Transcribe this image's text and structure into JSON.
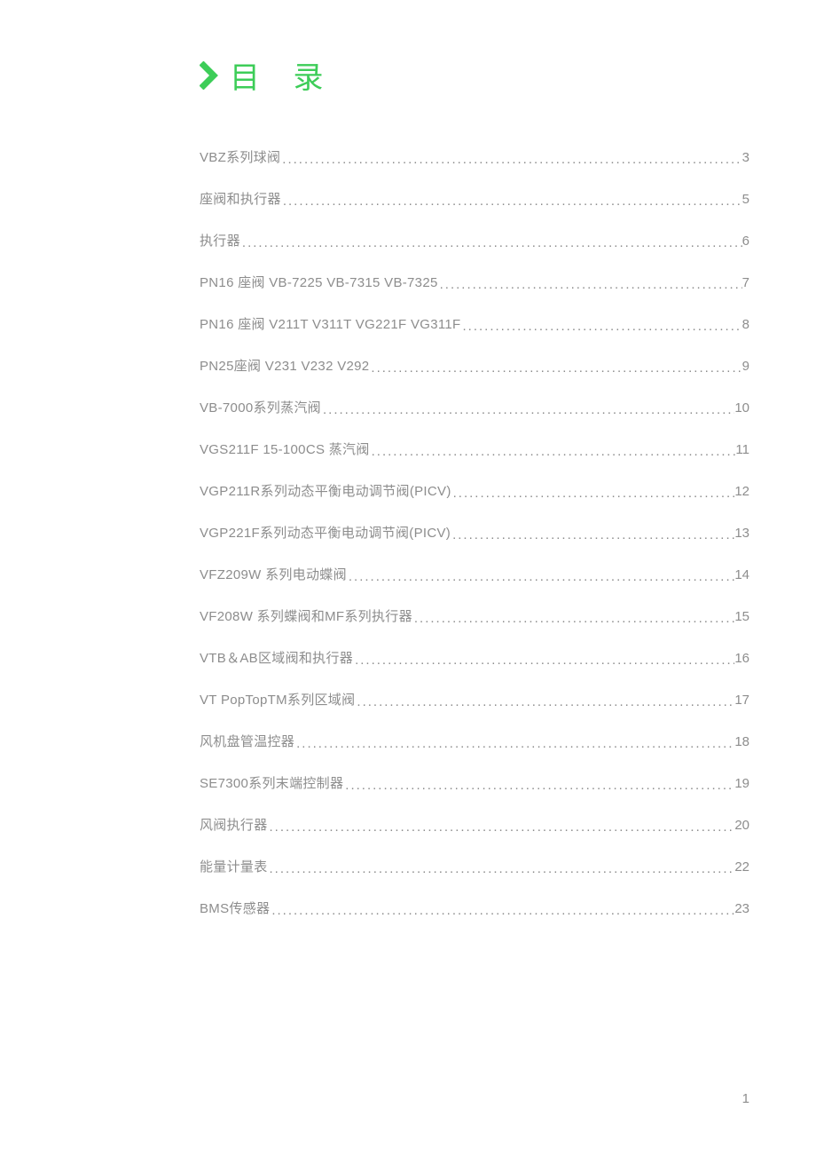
{
  "title": "目 录",
  "page_number": "1",
  "toc": [
    {
      "label": "VBZ系列球阀",
      "page": "3"
    },
    {
      "label": "座阀和执行器",
      "page": "5"
    },
    {
      "label": "执行器",
      "page": "6"
    },
    {
      "label": "PN16 座阀 VB-7225  VB-7315  VB-7325",
      "page": "7"
    },
    {
      "label": "PN16 座阀 V211T  V311T  VG221F  VG311F",
      "page": "8"
    },
    {
      "label": "PN25座阀 V231 V232 V292",
      "page": "9"
    },
    {
      "label": "VB-7000系列蒸汽阀",
      "page": "10"
    },
    {
      "label": "VGS211F 15-100CS 蒸汽阀",
      "page": "11"
    },
    {
      "label": "VGP211R系列动态平衡电动调节阀(PICV)",
      "page": "12"
    },
    {
      "label": "VGP221F系列动态平衡电动调节阀(PICV)",
      "page": "13"
    },
    {
      "label": "VFZ209W 系列电动蝶阀",
      "page": "14"
    },
    {
      "label": "VF208W 系列蝶阀和MF系列执行器",
      "page": "15"
    },
    {
      "label": "VTB＆AB区域阀和执行器",
      "page": "16"
    },
    {
      "label": "VT PopTopTM系列区域阀",
      "page": "17"
    },
    {
      "label": "风机盘管温控器",
      "page": "18"
    },
    {
      "label": "SE7300系列末端控制器",
      "page": "19"
    },
    {
      "label": "风阀执行器",
      "page": "20"
    },
    {
      "label": "能量计量表",
      "page": "22"
    },
    {
      "label": "BMS传感器",
      "page": "23"
    }
  ]
}
